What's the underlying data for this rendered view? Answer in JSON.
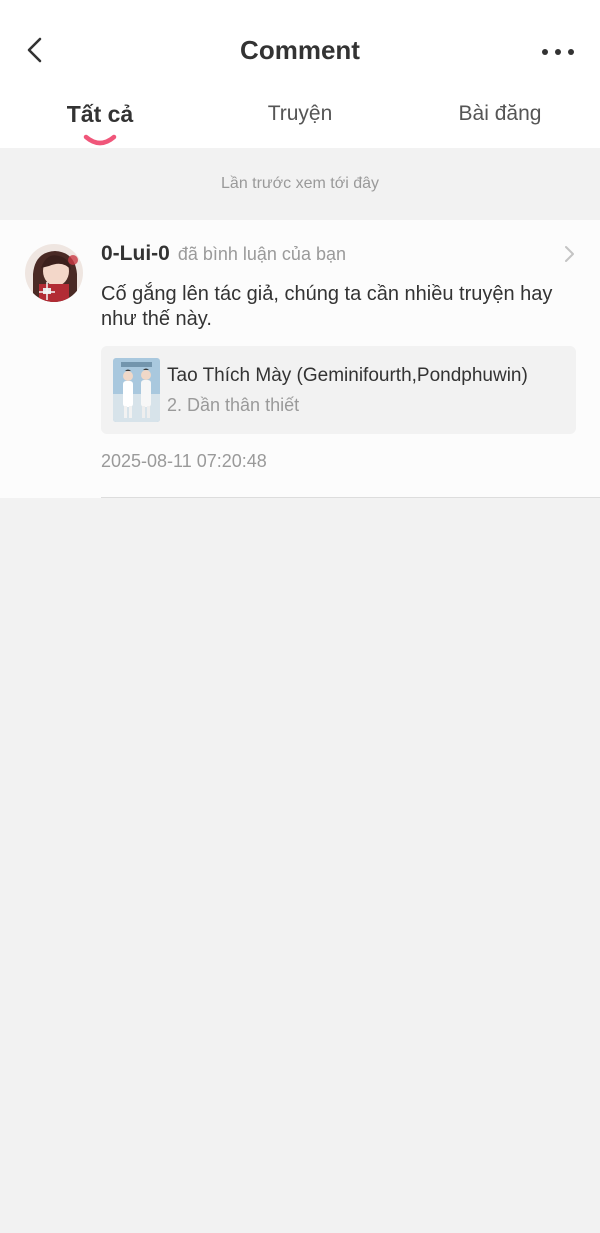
{
  "header": {
    "title": "Comment"
  },
  "tabs": [
    {
      "label": "Tất cả",
      "active": true
    },
    {
      "label": "Truyện",
      "active": false
    },
    {
      "label": "Bài đăng",
      "active": false
    }
  ],
  "divider_label": "Lần trước xem tới đây",
  "notification": {
    "username": "0-Lui-0",
    "action": "đã bình luận của bạn",
    "comment": "Cố gắng lên tác giả, chúng ta cần nhiều truyện hay như thế này.",
    "story": {
      "title": "Tao Thích Mày (Geminifourth,Pondphuwin)",
      "chapter": "2. Dần thân thiết"
    },
    "timestamp": "2025-08-11 07:20:48"
  },
  "colors": {
    "accent": "#f0567a",
    "background": "#f2f2f2",
    "card": "#fcfcfc",
    "text_primary": "#333333",
    "text_secondary": "#9a9a9a"
  },
  "icons": {
    "back": "back-arrow-icon",
    "more": "more-dots-icon",
    "chevron": "chevron-right-icon"
  }
}
